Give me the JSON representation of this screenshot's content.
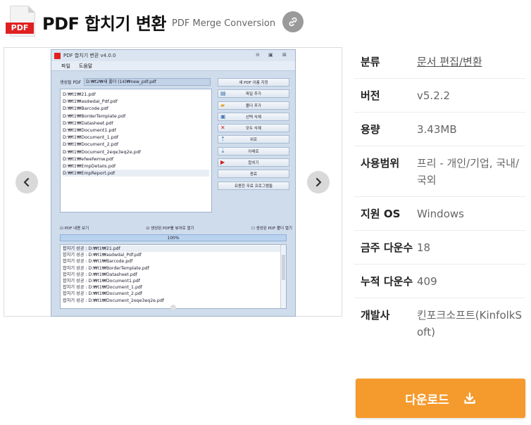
{
  "header": {
    "icon_text": "PDF",
    "title": "PDF 합치기 변환",
    "subtitle": "PDF Merge Conversion"
  },
  "app_window": {
    "title": "PDF 합치기 변환 v4.0.0",
    "menu": [
      "파일",
      "도움말"
    ],
    "output_label": "생성될 PDF",
    "output_path": "D:₩t2₩새 폴더 (14)₩new_pdf.pdf",
    "files": [
      "D:₩t1₩21.pdf",
      "D:₩t1₩asdwdal_Pdf.pdf",
      "D:₩t1₩Barcode.pdf",
      "D:₩t1₩BorderTemplate.pdf",
      "D:₩t1₩Datasheet.pdf",
      "D:₩t1₩Document1.pdf",
      "D:₩t1₩Document_1.pdf",
      "D:₩t1₩Document_2.pdf",
      "D:₩t1₩Document_2eqe3eq2e.pdf",
      "D:₩t1₩efwefwmw.pdf",
      "D:₩t1₩EmpDetails.pdf",
      "D:₩t1₩EmpReport.pdf"
    ],
    "buttons": [
      {
        "label": "새 PDF 이름 지정",
        "glyph": ""
      },
      {
        "label": "파일 추가",
        "glyph": "▤"
      },
      {
        "label": "폴더 추가",
        "glyph": "▰"
      },
      {
        "label": "선택 삭제",
        "glyph": "▣"
      },
      {
        "label": "모두 삭제",
        "glyph": "✕"
      },
      {
        "label": "위로",
        "glyph": "⇡"
      },
      {
        "label": "아래로",
        "glyph": "⇣"
      },
      {
        "label": "합치기",
        "glyph": "▶"
      },
      {
        "label": "종료",
        "glyph": ""
      },
      {
        "label": "유용한 무료 프로그램들",
        "glyph": ""
      }
    ],
    "check_view": "PDF 내용 보기",
    "check_open": "생성된 PDF를 뷰어로 열기",
    "check_folder": "생성된 PDF 폴더 열기",
    "progress": "100%",
    "log": [
      "합치기 성공 : D:₩t1₩21.pdf",
      "합치기 성공 : D:₩t1₩asdwdal_Pdf.pdf",
      "합치기 성공 : D:₩t1₩Barcode.pdf",
      "합치기 성공 : D:₩t1₩BorderTemplate.pdf",
      "합치기 성공 : D:₩t1₩Datasheet.pdf",
      "합치기 성공 : D:₩t1₩Document1.pdf",
      "합치기 성공 : D:₩t1₩Document_1.pdf",
      "합치기 성공 : D:₩t1₩Document_2.pdf",
      "합치기 성공 : D:₩t1₩Document_2eqe3eq2e.pdf"
    ]
  },
  "info": {
    "category_label": "분류",
    "category_value": "문서 편집/변환",
    "version_label": "버전",
    "version_value": "v5.2.2",
    "size_label": "용량",
    "size_value": "3.43MB",
    "license_label": "사용범위",
    "license_value": "프리 - 개인/기업, 국내/국외",
    "os_label": "지원 OS",
    "os_value": "Windows",
    "weekly_label": "금주 다운수",
    "weekly_value": "18",
    "total_label": "누적 다운수",
    "total_value": "409",
    "dev_label": "개발사",
    "dev_value": "킨포크소프트(KinfolkSoft)"
  },
  "download_label": "다운로드",
  "colors": {
    "accent": "#f59a2c",
    "pdf_red": "#e02020"
  }
}
